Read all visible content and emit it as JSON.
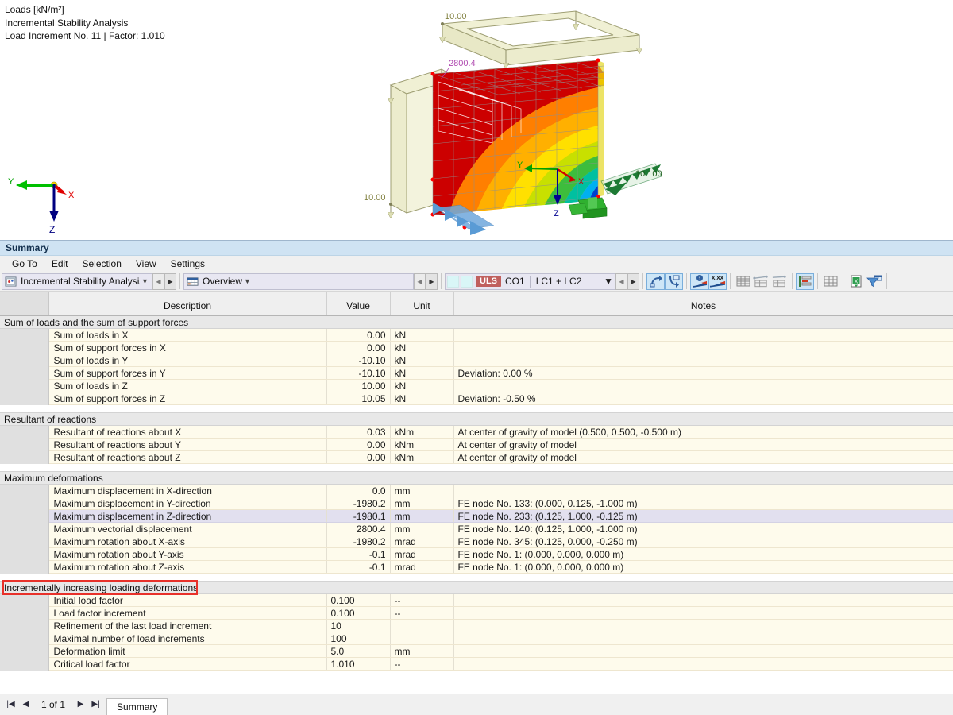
{
  "viewport": {
    "legend_lines": [
      "Loads [kN/m²]",
      "Incremental Stability Analysis",
      "Load Increment No. 11 | Factor: 1.010"
    ],
    "axis": {
      "x": "X",
      "y": "Y",
      "z": "Z"
    },
    "model_annotations": {
      "load_top": "10.00",
      "load_left": "10.00",
      "load_right": "10.100",
      "max_deformation": "2800.4"
    }
  },
  "panel": {
    "title": "Summary",
    "menu": [
      "Go To",
      "Edit",
      "Selection",
      "View",
      "Settings"
    ]
  },
  "toolbar": {
    "analysis_combo": "Incremental Stability Analysis",
    "view_combo": "Overview",
    "design_situation": "ULS",
    "combination": "CO1",
    "load_cases": "LC1 + LC2",
    "buttons": [
      "reference-length-icon",
      "reference-surface-icon",
      "show-result-values-icon",
      "show-numeric-values-icon",
      "table-all-icon",
      "table-line-icon",
      "table-member-icon",
      "table-diagram-icon",
      "table-grid-icon",
      "export-excel-icon",
      "filter-icon"
    ],
    "colors": {
      "uls_tag": "#c0605e",
      "active_button": "#cde6f7"
    }
  },
  "table": {
    "columns": [
      "",
      "Description",
      "Value",
      "Unit",
      "Notes"
    ],
    "groups": [
      {
        "title": "Sum of loads and the sum of support forces",
        "rows": [
          {
            "description": "Sum of loads in X",
            "value": "0.00",
            "unit": "kN",
            "notes": ""
          },
          {
            "description": "Sum of support forces in X",
            "value": "0.00",
            "unit": "kN",
            "notes": ""
          },
          {
            "description": "Sum of loads in Y",
            "value": "-10.10",
            "unit": "kN",
            "notes": ""
          },
          {
            "description": "Sum of support forces in Y",
            "value": "-10.10",
            "unit": "kN",
            "notes": "Deviation: 0.00 %"
          },
          {
            "description": "Sum of loads in Z",
            "value": "10.00",
            "unit": "kN",
            "notes": ""
          },
          {
            "description": "Sum of support forces in Z",
            "value": "10.05",
            "unit": "kN",
            "notes": "Deviation: -0.50 %"
          }
        ]
      },
      {
        "title": "Resultant of reactions",
        "rows": [
          {
            "description": "Resultant of reactions about X",
            "value": "0.03",
            "unit": "kNm",
            "notes": "At center of gravity of model (0.500, 0.500, -0.500 m)"
          },
          {
            "description": "Resultant of reactions about Y",
            "value": "0.00",
            "unit": "kNm",
            "notes": "At center of gravity of model"
          },
          {
            "description": "Resultant of reactions about Z",
            "value": "0.00",
            "unit": "kNm",
            "notes": "At center of gravity of model"
          }
        ]
      },
      {
        "title": "Maximum deformations",
        "rows": [
          {
            "description": "Maximum displacement in X-direction",
            "value": "0.0",
            "unit": "mm",
            "notes": ""
          },
          {
            "description": "Maximum displacement in Y-direction",
            "value": "-1980.2",
            "unit": "mm",
            "notes": "FE node No. 133: (0.000, 0.125, -1.000 m)"
          },
          {
            "description": "Maximum displacement in Z-direction",
            "value": "-1980.1",
            "unit": "mm",
            "notes": "FE node No. 233: (0.125, 1.000, -0.125 m)",
            "selected": true
          },
          {
            "description": "Maximum vectorial displacement",
            "value": "2800.4",
            "unit": "mm",
            "notes": "FE node No. 140: (0.125, 1.000, -1.000 m)"
          },
          {
            "description": "Maximum rotation about X-axis",
            "value": "-1980.2",
            "unit": "mrad",
            "notes": "FE node No. 345: (0.125, 0.000, -0.250 m)"
          },
          {
            "description": "Maximum rotation about Y-axis",
            "value": "-0.1",
            "unit": "mrad",
            "notes": "FE node No. 1: (0.000, 0.000, 0.000 m)"
          },
          {
            "description": "Maximum rotation about Z-axis",
            "value": "-0.1",
            "unit": "mrad",
            "notes": "FE node No. 1: (0.000, 0.000, 0.000 m)"
          }
        ]
      },
      {
        "title": "Incrementally increasing loading deformations",
        "highlighted": true,
        "left_align_values": true,
        "rows": [
          {
            "description": "Initial load factor",
            "value": "0.100",
            "unit": "--",
            "notes": ""
          },
          {
            "description": "Load factor increment",
            "value": "0.100",
            "unit": "--",
            "notes": ""
          },
          {
            "description": "Refinement of the last load increment",
            "value": "10",
            "unit": "",
            "notes": ""
          },
          {
            "description": "Maximal number of load increments",
            "value": "100",
            "unit": "",
            "notes": ""
          },
          {
            "description": "Deformation limit",
            "value": "5.0",
            "unit": "mm",
            "notes": ""
          },
          {
            "description": "Critical load factor",
            "value": "1.010",
            "unit": "--",
            "notes": ""
          }
        ]
      }
    ]
  },
  "status": {
    "page_indicator": "1 of 1",
    "first_label": "|◀",
    "prev_label": "◀",
    "next_label": "▶",
    "last_label": "▶|",
    "tabs": [
      {
        "label": "Summary",
        "active": true
      }
    ]
  }
}
